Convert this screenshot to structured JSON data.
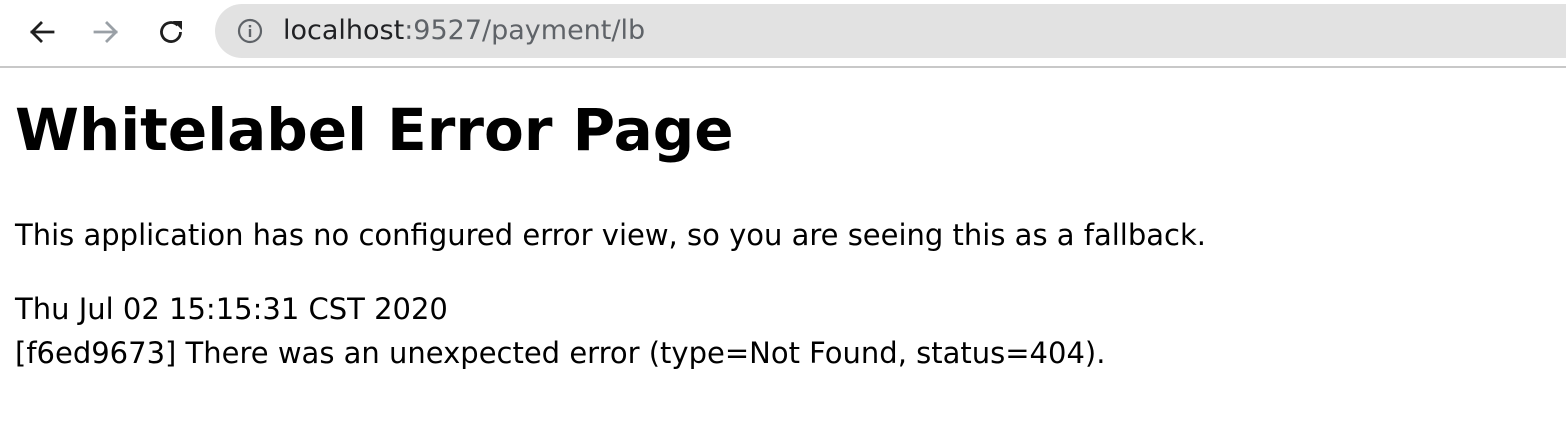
{
  "browser": {
    "url_host": "localhost",
    "url_rest": ":9527/payment/lb",
    "icons": {
      "back": "arrow-left-icon",
      "forward": "arrow-right-icon",
      "reload": "reload-icon",
      "site_info": "info-icon"
    },
    "colors": {
      "omnibox_bg": "#e2e2e2",
      "forward_disabled": "#9aa0a6"
    }
  },
  "page": {
    "title": "Whitelabel Error Page",
    "message": "This application has no configured error view, so you are seeing this as a fallback.",
    "timestamp": "Thu Jul 02 15:15:31 CST 2020",
    "error_detail": "[f6ed9673] There was an unexpected error (type=Not Found, status=404)."
  }
}
